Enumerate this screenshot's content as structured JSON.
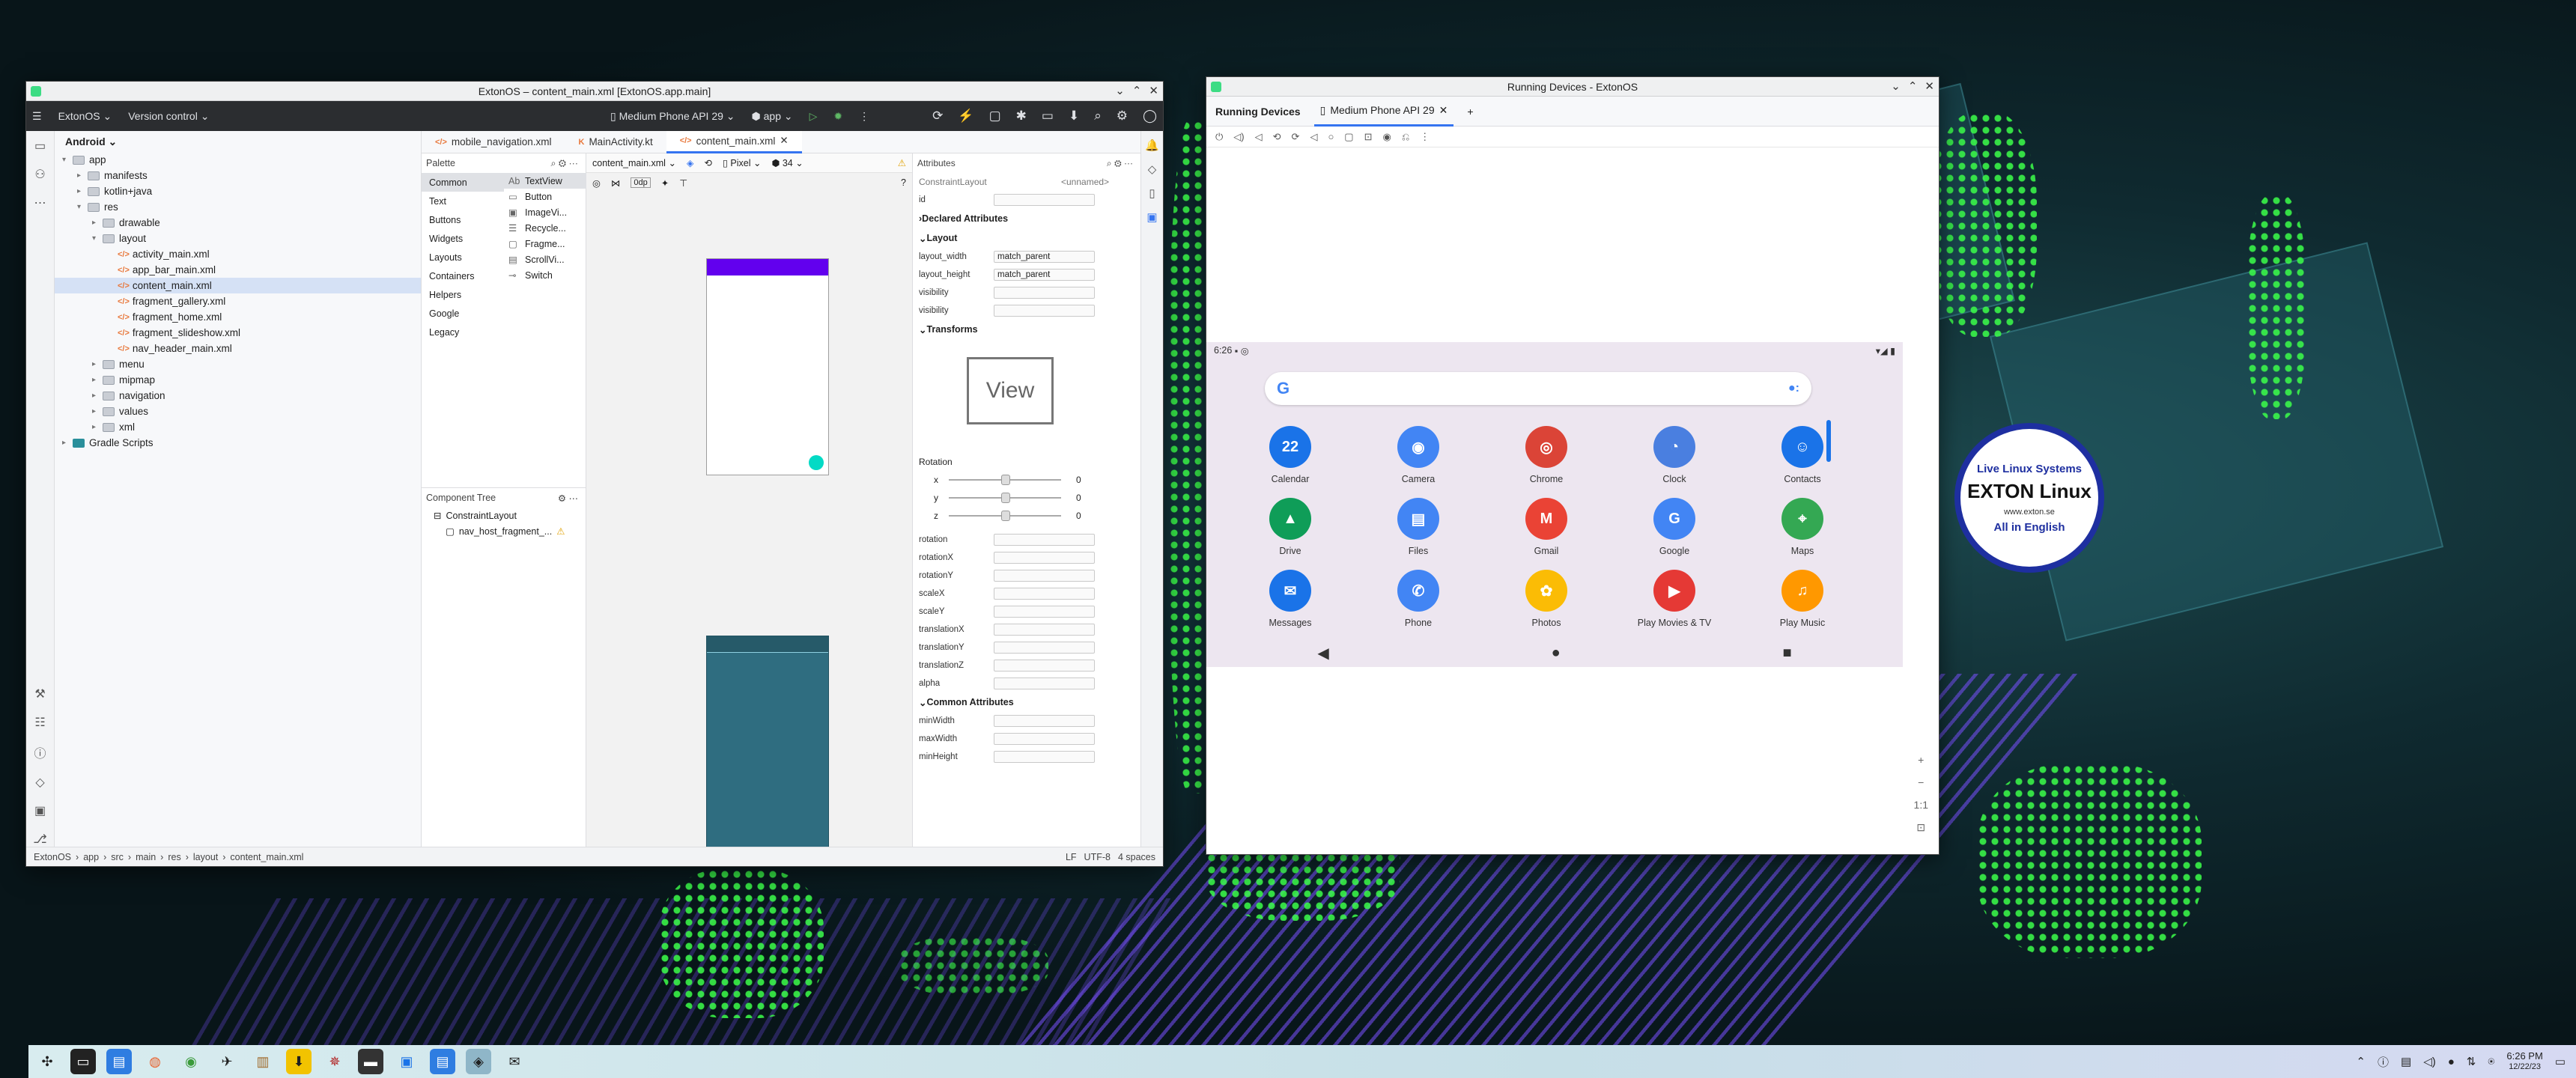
{
  "ide_window": {
    "title": "ExtonOS – content_main.xml [ExtonOS.app.main]",
    "project": "ExtonOS",
    "vcs": "Version control",
    "device": "Medium Phone API 29",
    "config": "app",
    "project_view": "Android",
    "tree": [
      {
        "label": "app",
        "depth": 0,
        "type": "folder",
        "arrow": "▾"
      },
      {
        "label": "manifests",
        "depth": 1,
        "type": "folder",
        "arrow": "▸"
      },
      {
        "label": "kotlin+java",
        "depth": 1,
        "type": "folder",
        "arrow": "▸"
      },
      {
        "label": "res",
        "depth": 1,
        "type": "folder",
        "arrow": "▾"
      },
      {
        "label": "drawable",
        "depth": 2,
        "type": "folder",
        "arrow": "▸"
      },
      {
        "label": "layout",
        "depth": 2,
        "type": "folder",
        "arrow": "▾"
      },
      {
        "label": "activity_main.xml",
        "depth": 3,
        "type": "xml",
        "arrow": ""
      },
      {
        "label": "app_bar_main.xml",
        "depth": 3,
        "type": "xml",
        "arrow": ""
      },
      {
        "label": "content_main.xml",
        "depth": 3,
        "type": "xml",
        "arrow": "",
        "selected": true
      },
      {
        "label": "fragment_gallery.xml",
        "depth": 3,
        "type": "xml",
        "arrow": ""
      },
      {
        "label": "fragment_home.xml",
        "depth": 3,
        "type": "xml",
        "arrow": ""
      },
      {
        "label": "fragment_slideshow.xml",
        "depth": 3,
        "type": "xml",
        "arrow": ""
      },
      {
        "label": "nav_header_main.xml",
        "depth": 3,
        "type": "xml",
        "arrow": ""
      },
      {
        "label": "menu",
        "depth": 2,
        "type": "folder",
        "arrow": "▸"
      },
      {
        "label": "mipmap",
        "depth": 2,
        "type": "folder",
        "arrow": "▸"
      },
      {
        "label": "navigation",
        "depth": 2,
        "type": "folder",
        "arrow": "▸"
      },
      {
        "label": "values",
        "depth": 2,
        "type": "folder",
        "arrow": "▸"
      },
      {
        "label": "xml",
        "depth": 2,
        "type": "folder",
        "arrow": "▸"
      },
      {
        "label": "Gradle Scripts",
        "depth": 0,
        "type": "gradle",
        "arrow": "▸"
      }
    ],
    "tabs": [
      "mobile_navigation.xml",
      "MainActivity.kt",
      "content_main.xml"
    ],
    "palette": {
      "title": "Palette",
      "categories": [
        "Common",
        "Text",
        "Buttons",
        "Widgets",
        "Layouts",
        "Containers",
        "Helpers",
        "Google",
        "Legacy"
      ],
      "items": [
        {
          "g": "Ab",
          "t": "TextView"
        },
        {
          "g": "▭",
          "t": "Button"
        },
        {
          "g": "▣",
          "t": "ImageVi..."
        },
        {
          "g": "☰",
          "t": "Recycle..."
        },
        {
          "g": "▢",
          "t": "Fragme..."
        },
        {
          "g": "▤",
          "t": "ScrollVi..."
        },
        {
          "g": "⊸",
          "t": "Switch"
        }
      ]
    },
    "canvas": {
      "file": "content_main.xml",
      "dp": "0dp",
      "device": "Pixel",
      "api": "34"
    },
    "component_tree": {
      "title": "Component Tree",
      "root": "ConstraintLayout",
      "child": "nav_host_fragment_..."
    },
    "attributes": {
      "title": "Attributes",
      "type": "ConstraintLayout",
      "name": "<unnamed>",
      "id_label": "id",
      "declared": "Declared Attributes",
      "layout": "Layout",
      "layout_rows": [
        {
          "k": "layout_width",
          "v": "match_parent"
        },
        {
          "k": "layout_height",
          "v": "match_parent"
        },
        {
          "k": "visibility",
          "v": ""
        },
        {
          "k": "visibility",
          "v": ""
        }
      ],
      "transforms": "Transforms",
      "view": "View",
      "rotation": "Rotation",
      "axes": [
        {
          "k": "x",
          "v": "0"
        },
        {
          "k": "y",
          "v": "0"
        },
        {
          "k": "z",
          "v": "0"
        }
      ],
      "props": [
        "rotation",
        "rotationX",
        "rotationY",
        "scaleX",
        "scaleY",
        "translationX",
        "translationY",
        "translationZ",
        "alpha"
      ],
      "common": "Common Attributes",
      "common_rows": [
        "minWidth",
        "maxWidth",
        "minHeight"
      ]
    },
    "status": {
      "crumbs": [
        "ExtonOS",
        "app",
        "src",
        "main",
        "res",
        "layout",
        "content_main.xml"
      ],
      "lf": "LF",
      "enc": "UTF-8",
      "indent": "4 spaces"
    }
  },
  "device_window": {
    "title": "Running Devices - ExtonOS",
    "panel": "Running Devices",
    "device_tab": "Medium Phone API 29",
    "time": "6:26",
    "zoom": "1:1",
    "apps": [
      {
        "name": "Calendar",
        "color": "#1a73e8",
        "g": "22"
      },
      {
        "name": "Camera",
        "color": "#4285f4",
        "g": "◉"
      },
      {
        "name": "Chrome",
        "color": "#db4437",
        "g": "◎"
      },
      {
        "name": "Clock",
        "color": "#4a7fe0",
        "g": "◔"
      },
      {
        "name": "Contacts",
        "color": "#1a73e8",
        "g": "☺"
      },
      {
        "name": "Drive",
        "color": "#0f9d58",
        "g": "▲"
      },
      {
        "name": "Files",
        "color": "#4285f4",
        "g": "▤"
      },
      {
        "name": "Gmail",
        "color": "#ea4335",
        "g": "M"
      },
      {
        "name": "Google",
        "color": "#4285f4",
        "g": "G"
      },
      {
        "name": "Maps",
        "color": "#34a853",
        "g": "⌖"
      },
      {
        "name": "Messages",
        "color": "#1a73e8",
        "g": "✉"
      },
      {
        "name": "Phone",
        "color": "#4285f4",
        "g": "✆"
      },
      {
        "name": "Photos",
        "color": "#fbbc05",
        "g": "✿"
      },
      {
        "name": "Play Movies & TV",
        "color": "#e53935",
        "g": "▶"
      },
      {
        "name": "Play Music",
        "color": "#ff9800",
        "g": "♫"
      }
    ]
  },
  "taskbar": {
    "time": "6:26 PM",
    "date": "12/22/23"
  },
  "stamp": {
    "top": "Live Linux Systems",
    "brand": "EXTON Linux",
    "site": "www.exton.se",
    "bottom": "All in English"
  },
  "colors": {
    "accent": "#3574f0",
    "toolbar": "#2b2d30",
    "appbar_purple": "#6200ee"
  }
}
